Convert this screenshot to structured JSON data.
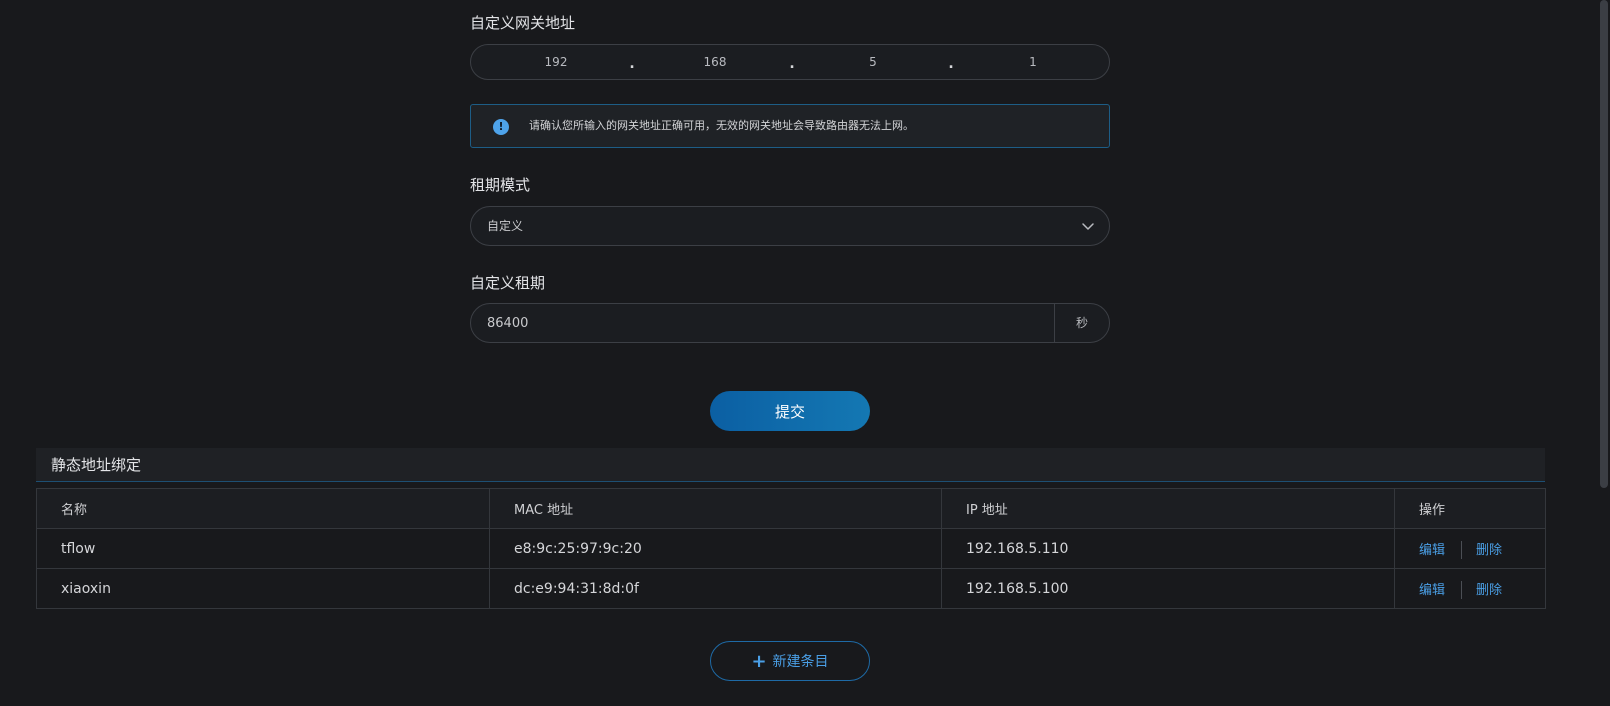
{
  "gateway": {
    "label": "自定义网关地址",
    "octets": [
      "192",
      "168",
      "5",
      "1"
    ],
    "dot": "."
  },
  "alert": {
    "icon": "info-icon",
    "icon_glyph": "!",
    "text": "请确认您所输入的网关地址正确可用，无效的网关地址会导致路由器无法上网。"
  },
  "lease_mode": {
    "label": "租期模式",
    "value": "自定义"
  },
  "custom_lease": {
    "label": "自定义租期",
    "value": "86400",
    "unit": "秒"
  },
  "submit": {
    "label": "提交"
  },
  "static_binding": {
    "title": "静态地址绑定",
    "columns": [
      "名称",
      "MAC 地址",
      "IP 地址",
      "操作"
    ],
    "rows": [
      {
        "name": "tflow",
        "mac": "e8:9c:25:97:9c:20",
        "ip": "192.168.5.110"
      },
      {
        "name": "xiaoxin",
        "mac": "dc:e9:94:31:8d:0f",
        "ip": "192.168.5.100"
      }
    ],
    "actions": {
      "edit": "编辑",
      "delete": "删除"
    },
    "new_entry": {
      "plus": "+",
      "label": "新建条目"
    }
  },
  "colors": {
    "background": "#18191c",
    "accent": "#4a9fe6",
    "primary_button": "#0b5fa3"
  }
}
